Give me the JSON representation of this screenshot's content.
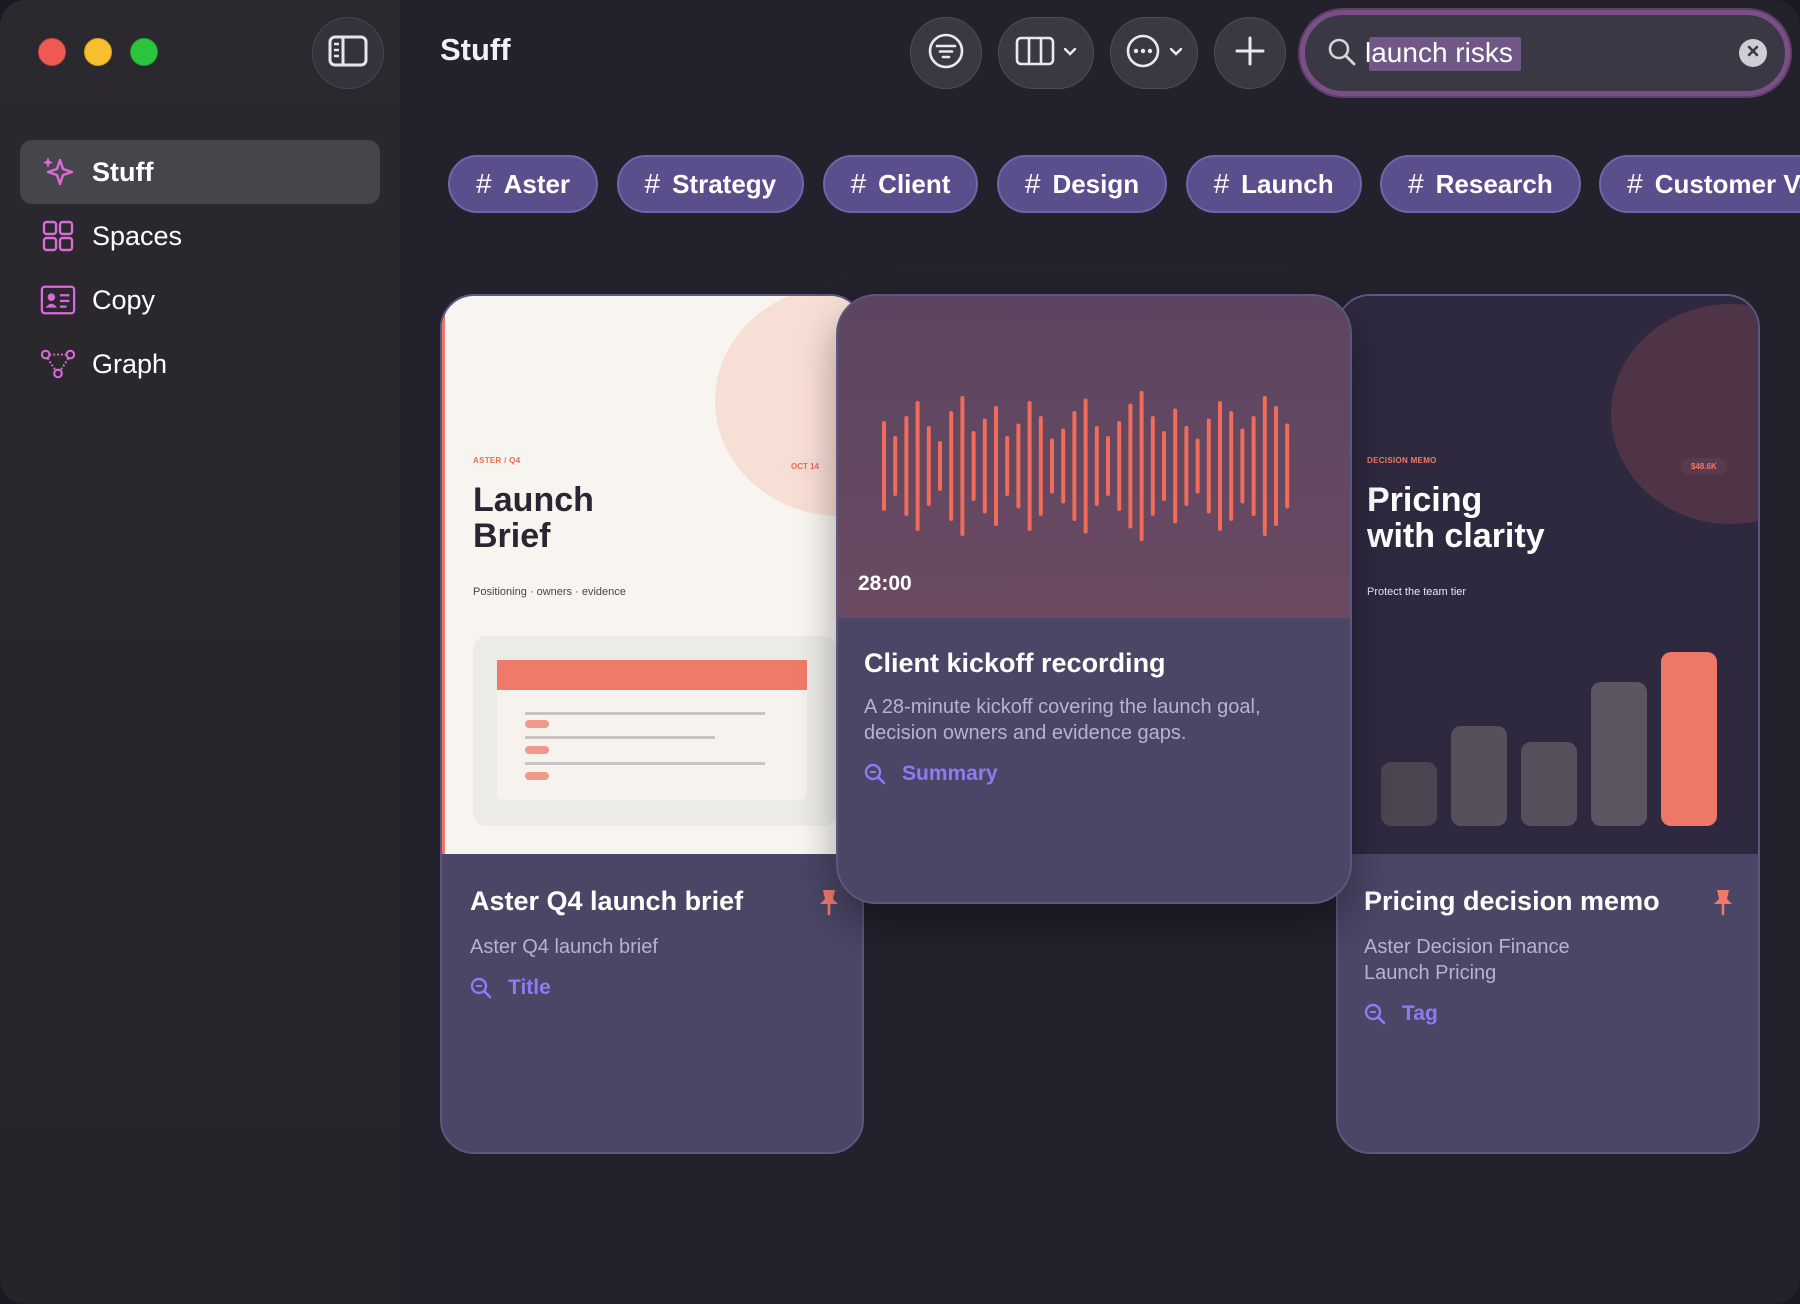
{
  "window": {
    "title": "Stuff"
  },
  "sidebar": {
    "items": [
      {
        "label": "Stuff",
        "icon": "sparkle-icon",
        "active": true
      },
      {
        "label": "Spaces",
        "icon": "grid-icon",
        "active": false
      },
      {
        "label": "Copy",
        "icon": "contact-card-icon",
        "active": false
      },
      {
        "label": "Graph",
        "icon": "graph-icon",
        "active": false
      }
    ]
  },
  "toolbar": {
    "filter_icon": "filter-icon",
    "columns_icon": "columns-icon",
    "more_icon": "more-icon",
    "add_icon": "plus-icon"
  },
  "search": {
    "value": "launch risks",
    "placeholder": ""
  },
  "tags": [
    "Aster",
    "Strategy",
    "Client",
    "Design",
    "Launch",
    "Research",
    "Customer Voice"
  ],
  "colors": {
    "accent": "#8b7cf2",
    "tag_bg": "#5a4e8c",
    "coral": "#ee7868",
    "card_bg": "#4b4566",
    "app_bg": "#23222c"
  },
  "cards": [
    {
      "thumb": {
        "kicker": "ASTER / Q4",
        "badge": "OCT 14",
        "title_line1": "Launch",
        "title_line2": "Brief",
        "subtitle": "Positioning · owners · evidence"
      },
      "title": "Aster Q4 launch brief",
      "description": "Aster Q4 launch brief",
      "match_label": "Title",
      "pinned": true
    },
    {
      "thumb": {
        "duration": "28:00"
      },
      "title": "Client kickoff recording",
      "description_line1": "A 28-minute kickoff covering the launch goal,",
      "description_line2": "decision owners and evidence gaps.",
      "match_label": "Summary",
      "pinned": false
    },
    {
      "thumb": {
        "kicker": "DECISION MEMO",
        "badge": "$48.6K",
        "title_line1": "Pricing",
        "title_line2": "with clarity",
        "subtitle": "Protect the team tier"
      },
      "title": "Pricing decision memo",
      "description_line1": "Aster Decision Finance",
      "description_line2": "Launch Pricing",
      "match_label": "Tag",
      "pinned": true
    }
  ]
}
